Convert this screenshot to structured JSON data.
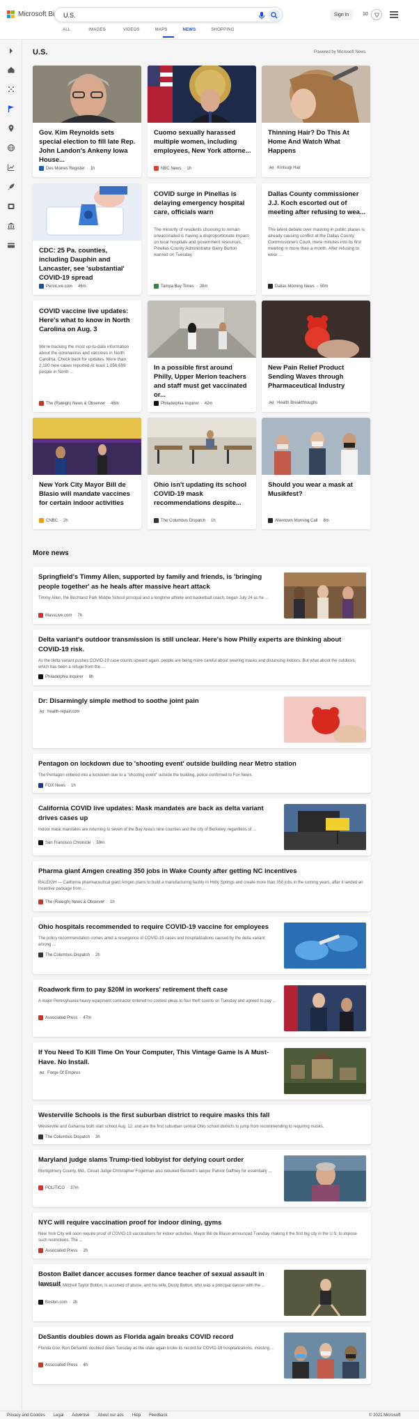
{
  "header": {
    "brand": "Microsoft Bing",
    "search_value": "U.S.",
    "sign_in": "Sign in",
    "points": "10",
    "tabs": [
      {
        "label": "ALL"
      },
      {
        "label": "IMAGES"
      },
      {
        "label": "VIDEOS"
      },
      {
        "label": "MAPS"
      },
      {
        "label": "NEWS"
      },
      {
        "label": "SHOPPING"
      }
    ],
    "active_tab": "NEWS",
    "accent_color": "#174ae4"
  },
  "rail": {
    "icons": [
      "expand-icon",
      "home-icon",
      "scatter-icon",
      "flag-icon",
      "location-icon",
      "globe-icon",
      "chart-icon",
      "rocket-icon",
      "film-icon",
      "bank-icon",
      "card-icon"
    ]
  },
  "section": {
    "title": "U.S.",
    "powered_by": "Powered by Microsoft News"
  },
  "cards": [
    {
      "title": "Gov. Kim Reynolds sets special election to fill late Rep. John Landon's Ankeny Iowa House...",
      "snippet": "",
      "ad": "",
      "source": "Des Moines Register",
      "time": "1h",
      "logo_color": "#1e5ba8"
    },
    {
      "title": "Cuomo sexually harassed multiple women, including employees, New York attorne...",
      "snippet": "",
      "ad": "",
      "source": "NBC News",
      "time": "1h",
      "logo_color": "#e03e2d"
    },
    {
      "title": "Thinning Hair? Do This At Home And Watch What Happens",
      "snippet": "",
      "ad": "Ad",
      "source": "Kintsugi Hair",
      "time": "",
      "logo_color": ""
    },
    {
      "title": "CDC: 25 Pa. counties, including Dauphin and Lancaster, see 'substantial' COVID-19 spread",
      "snippet": "",
      "ad": "",
      "source": "PennLive.com",
      "time": "46m",
      "logo_color": "#1f4e9b"
    },
    {
      "title": "COVID surge in Pinellas is delaying emergency hospital care, officials warn",
      "snippet": "The minority of residents choosing to remain unvaccinated is having a disproportionate impact on local hospitals and government resources, Pinellas County Administrator Barry Burton warned on Tuesday",
      "ad": "",
      "source": "Tampa Bay Times",
      "time": "28m",
      "logo_color": "#2b8a3e"
    },
    {
      "title": "Dallas County commissioner J.J. Koch escorted out of meeting after refusing to wea...",
      "snippet": "The latest debate over masking in public places is already causing conflict at the Dallas County Commissioners Court, mere minutes into its first meeting in more than a month. After refusing to wear ...",
      "ad": "",
      "source": "Dallas Morning News",
      "time": "50m",
      "logo_color": "#222"
    },
    {
      "title": "COVID vaccine live updates: Here's what to know in North Carolina on Aug. 3",
      "snippet": "We're tracking the most up-to-date information about the coronavirus and vaccines in North Carolina. Check back for updates. More than 2,100 new cases reported At least 1,056,699 people in North ...",
      "ad": "",
      "source": "The (Raleigh) News & Observer",
      "time": "48m",
      "logo_color": "#c0392b"
    },
    {
      "title": "In a possible first around Philly, Upper Merion teachers and staff must get vaccinated or...",
      "snippet": "",
      "ad": "",
      "source": "Philadelphia Inquirer",
      "time": "42m",
      "logo_color": "#111"
    },
    {
      "title": "New Pain Relief Product Sending Waves through Pharmaceutical Industry",
      "snippet": "",
      "ad": "Ad",
      "source": "Health Breakthroughs",
      "time": "",
      "logo_color": ""
    },
    {
      "title": "New York City Mayor Bill de Blasio will mandate vaccines for certain indoor activities",
      "snippet": "",
      "ad": "",
      "source": "CNBC",
      "time": "2h",
      "logo_color": "#f39c12"
    },
    {
      "title": "Ohio isn't updating its school COVID-19 mask recommendations despite...",
      "snippet": "",
      "ad": "",
      "source": "The Columbus Dispatch",
      "time": "1h",
      "logo_color": "#333"
    },
    {
      "title": "Should you wear a mask at Musikfest?",
      "snippet": "",
      "ad": "",
      "source": "Allentown Morning Call",
      "time": "8m",
      "logo_color": "#222"
    }
  ],
  "more_news": {
    "title": "More news",
    "items": [
      {
        "title": "Springfield's Timmy Allen, supported by family and friends, is 'bringing people together' as he heals after massive heart attack",
        "snippet": "Timmy Allen, the Birchland Park Middle School principal and a longtime athlete and basketball coach, began July 24 as he ...",
        "ad": "",
        "source": "MassLive.com",
        "time": "7h",
        "logo_color": "#d63031"
      },
      {
        "title": "Delta variant's outdoor transmission is still unclear. Here's how Philly experts are thinking about COVID-19 risk.",
        "snippet": "As the delta variant pushes COVID-19 case counts upward again, people are being more careful about wearing masks and distancing indoors. But what about the outdoors, which has been a refuge from the ...",
        "ad": "",
        "source": "Philadelphia Inquirer",
        "time": "8h",
        "logo_color": "#111"
      },
      {
        "title": "Dr: Disarmingly simple method to soothe joint pain",
        "snippet": "",
        "ad": "Ad",
        "source": "health-repair.com",
        "time": "",
        "logo_color": ""
      },
      {
        "title": "Pentagon on lockdown due to 'shooting event' outside building near Metro station",
        "snippet": "The Pentagon entered into a lockdown due to a \"shooting event\" outside the building, police confirmed to Fox News.",
        "ad": "",
        "source": "FOX News",
        "time": "1h",
        "logo_color": "#1a3a8f"
      },
      {
        "title": "California COVID live updates: Mask mandates are back as delta variant drives cases up",
        "snippet": "Indoor mask mandates are returning to seven of the Bay Area's nine counties and the city of Berkeley, regardless of ...",
        "ad": "",
        "source": "San Francisco Chronicle",
        "time": "59m",
        "logo_color": "#111"
      },
      {
        "title": "Pharma giant Amgen creating 350 jobs in Wake County after getting NC incentives",
        "snippet": "RALEIGH — California pharmaceutical giant Amgen plans to build a manufacturing facility in Holly Springs and create more than 350 jobs in the coming years, after it landed an incentive package from ...",
        "ad": "",
        "source": "The (Raleigh) News & Observer",
        "time": "1h",
        "logo_color": "#c0392b"
      },
      {
        "title": "Ohio hospitals recommended to require COVID-19 vaccine for employees",
        "snippet": "The policy recommendation comes amid a resurgence of COVID-19 cases and hospitalizations caused by the delta variant among ...",
        "ad": "",
        "source": "The Columbus Dispatch",
        "time": "2h",
        "logo_color": "#333"
      },
      {
        "title": "Roadwork firm to pay $20M in workers' retirement theft case",
        "snippet": "A major Pennsylvania heavy equipment contractor entered no contest pleas to four theft counts on Tuesday and agreed to pay ...",
        "ad": "",
        "source": "Associated Press",
        "time": "47m",
        "logo_color": "#c0392b"
      },
      {
        "title": "If You Need To Kill Time On Your Computer, This Vintage Game Is A Must-Have. No Install.",
        "snippet": "",
        "ad": "Ad",
        "source": "Forge Of Empires",
        "time": "",
        "logo_color": ""
      },
      {
        "title": "Westerville Schools is the first suburban district to require masks this fall",
        "snippet": "Westerville and Gahanna both start school Aug. 12, and are the first suburban central Ohio school districts to jump from recommending to requiring masks.",
        "ad": "",
        "source": "The Columbus Dispatch",
        "time": "3h",
        "logo_color": "#333"
      },
      {
        "title": "Maryland judge slams Trump-tied lobbyist for defying court order",
        "snippet": "Montgomery County, Md., Circuit Judge Christopher Fogelman also rebuked Bennett's lawyer Patrick Gaffney for essentially ...",
        "ad": "",
        "source": "POLITICO",
        "time": "37m",
        "logo_color": "#d63031"
      },
      {
        "title": "NYC will require vaccination proof for indoor dining, gyms",
        "snippet": "New York City will soon require proof of COVID-19 vaccinations for indoor activities, Mayor Bill de Blasio announced Tuesday, making it the first big city in the U.S. to impose such restrictions. The ...",
        "ad": "",
        "source": "Associated Press",
        "time": "2h",
        "logo_color": "#c0392b"
      },
      {
        "title": "Boston Ballet dancer accuses former dance teacher of sexual assault in lawsuit",
        "snippet": "The teacher, Mitchell Taylor Button, is accused of abuse, and his wife, Dusty Button, who was a principal dancer with the ...",
        "ad": "",
        "source": "Boston.com",
        "time": "2h",
        "logo_color": "#111"
      },
      {
        "title": "DeSantis doubles down as Florida again breaks COVID record",
        "snippet": "Florida Gov. Ron DeSantis doubled down Tuesday as the state again broke its record for COVID-19 hospitalizations, insisting ...",
        "ad": "",
        "source": "Associated Press",
        "time": "4h",
        "logo_color": "#c0392b"
      }
    ]
  },
  "footer": {
    "links": [
      "Privacy and Cookies",
      "Legal",
      "Advertise",
      "About our ads",
      "Help",
      "Feedback"
    ],
    "copyright": "© 2021 Microsoft"
  }
}
